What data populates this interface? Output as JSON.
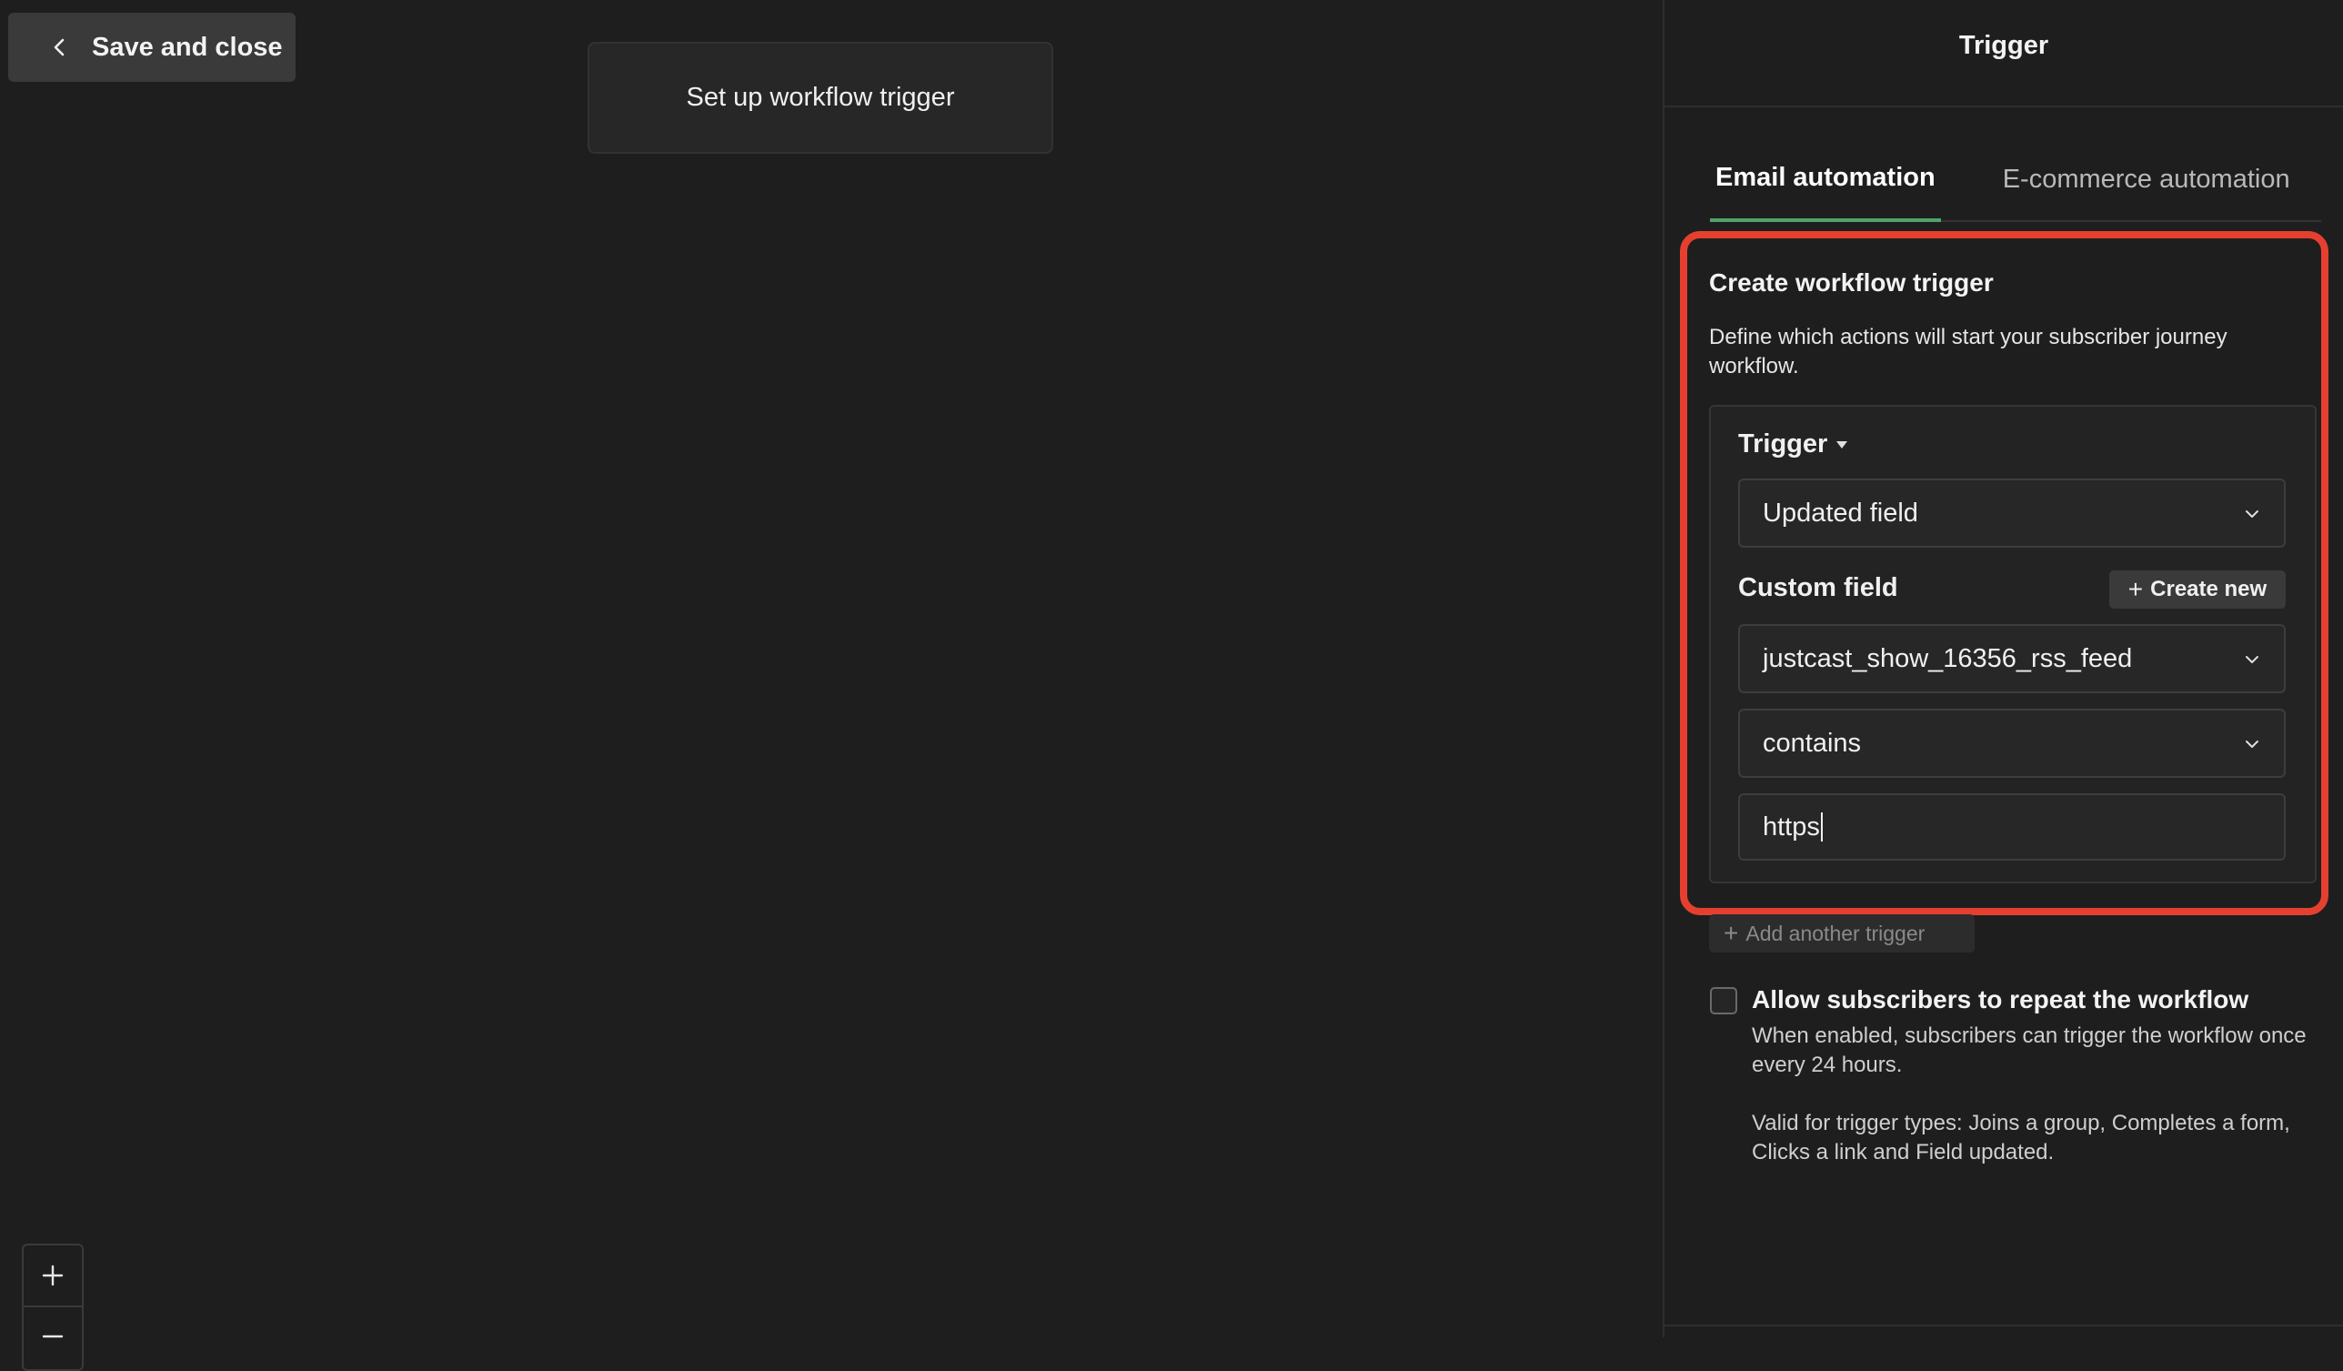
{
  "toolbar": {
    "save_close_label": "Save and close"
  },
  "canvas": {
    "node_label": "Set up workflow trigger",
    "zoom_in": "+",
    "zoom_out": "–"
  },
  "panel": {
    "title": "Trigger",
    "tabs": [
      {
        "label": "Email automation",
        "active": true
      },
      {
        "label": "E-commerce automation",
        "active": false
      }
    ],
    "card": {
      "title": "Create workflow trigger",
      "description": "Define which actions will start your subscriber journey workflow.",
      "trigger_label": "Trigger",
      "trigger_value": "Updated field",
      "custom_field_label": "Custom field",
      "create_new_label": "Create new",
      "custom_field_value": "justcast_show_16356_rss_feed",
      "condition_value": "contains",
      "input_value": "https"
    },
    "add_trigger_label": "Add another trigger",
    "repeat": {
      "label": "Allow subscribers to repeat the workflow",
      "help": "When enabled, subscribers can trigger the workflow once every 24 hours.",
      "help2": "Valid for trigger types: Joins a group, Completes a form, Clicks a link and Field updated.",
      "checked": false
    }
  },
  "colors": {
    "background": "#1e1e1e",
    "highlight_border": "#e5402f",
    "active_tab_underline": "#4fa36a"
  },
  "icons": [
    "chevron-left-icon",
    "chevron-down-icon",
    "plus-icon",
    "minus-icon"
  ]
}
